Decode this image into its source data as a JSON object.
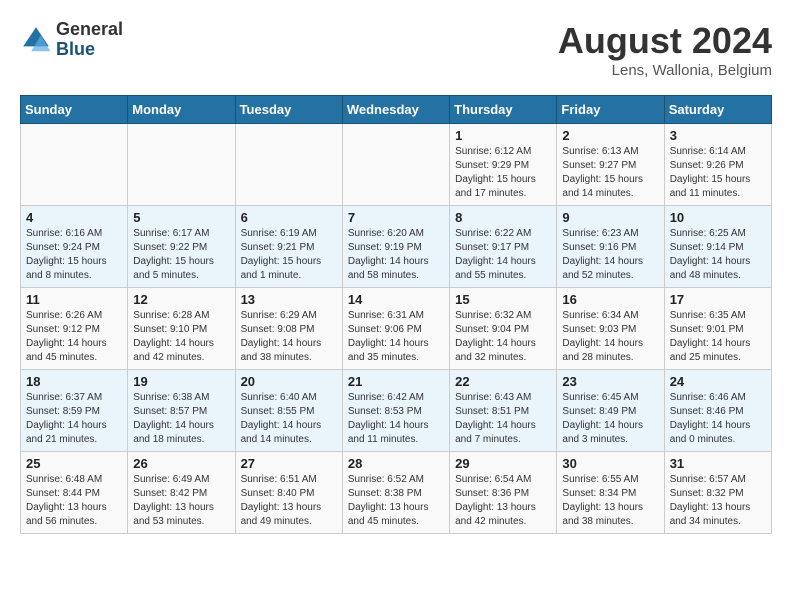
{
  "header": {
    "logo_general": "General",
    "logo_blue": "Blue",
    "month_title": "August 2024",
    "location": "Lens, Wallonia, Belgium"
  },
  "weekdays": [
    "Sunday",
    "Monday",
    "Tuesday",
    "Wednesday",
    "Thursday",
    "Friday",
    "Saturday"
  ],
  "weeks": [
    [
      {
        "day": "",
        "content": ""
      },
      {
        "day": "",
        "content": ""
      },
      {
        "day": "",
        "content": ""
      },
      {
        "day": "",
        "content": ""
      },
      {
        "day": "1",
        "content": "Sunrise: 6:12 AM\nSunset: 9:29 PM\nDaylight: 15 hours and 17 minutes."
      },
      {
        "day": "2",
        "content": "Sunrise: 6:13 AM\nSunset: 9:27 PM\nDaylight: 15 hours and 14 minutes."
      },
      {
        "day": "3",
        "content": "Sunrise: 6:14 AM\nSunset: 9:26 PM\nDaylight: 15 hours and 11 minutes."
      }
    ],
    [
      {
        "day": "4",
        "content": "Sunrise: 6:16 AM\nSunset: 9:24 PM\nDaylight: 15 hours and 8 minutes."
      },
      {
        "day": "5",
        "content": "Sunrise: 6:17 AM\nSunset: 9:22 PM\nDaylight: 15 hours and 5 minutes."
      },
      {
        "day": "6",
        "content": "Sunrise: 6:19 AM\nSunset: 9:21 PM\nDaylight: 15 hours and 1 minute."
      },
      {
        "day": "7",
        "content": "Sunrise: 6:20 AM\nSunset: 9:19 PM\nDaylight: 14 hours and 58 minutes."
      },
      {
        "day": "8",
        "content": "Sunrise: 6:22 AM\nSunset: 9:17 PM\nDaylight: 14 hours and 55 minutes."
      },
      {
        "day": "9",
        "content": "Sunrise: 6:23 AM\nSunset: 9:16 PM\nDaylight: 14 hours and 52 minutes."
      },
      {
        "day": "10",
        "content": "Sunrise: 6:25 AM\nSunset: 9:14 PM\nDaylight: 14 hours and 48 minutes."
      }
    ],
    [
      {
        "day": "11",
        "content": "Sunrise: 6:26 AM\nSunset: 9:12 PM\nDaylight: 14 hours and 45 minutes."
      },
      {
        "day": "12",
        "content": "Sunrise: 6:28 AM\nSunset: 9:10 PM\nDaylight: 14 hours and 42 minutes."
      },
      {
        "day": "13",
        "content": "Sunrise: 6:29 AM\nSunset: 9:08 PM\nDaylight: 14 hours and 38 minutes."
      },
      {
        "day": "14",
        "content": "Sunrise: 6:31 AM\nSunset: 9:06 PM\nDaylight: 14 hours and 35 minutes."
      },
      {
        "day": "15",
        "content": "Sunrise: 6:32 AM\nSunset: 9:04 PM\nDaylight: 14 hours and 32 minutes."
      },
      {
        "day": "16",
        "content": "Sunrise: 6:34 AM\nSunset: 9:03 PM\nDaylight: 14 hours and 28 minutes."
      },
      {
        "day": "17",
        "content": "Sunrise: 6:35 AM\nSunset: 9:01 PM\nDaylight: 14 hours and 25 minutes."
      }
    ],
    [
      {
        "day": "18",
        "content": "Sunrise: 6:37 AM\nSunset: 8:59 PM\nDaylight: 14 hours and 21 minutes."
      },
      {
        "day": "19",
        "content": "Sunrise: 6:38 AM\nSunset: 8:57 PM\nDaylight: 14 hours and 18 minutes."
      },
      {
        "day": "20",
        "content": "Sunrise: 6:40 AM\nSunset: 8:55 PM\nDaylight: 14 hours and 14 minutes."
      },
      {
        "day": "21",
        "content": "Sunrise: 6:42 AM\nSunset: 8:53 PM\nDaylight: 14 hours and 11 minutes."
      },
      {
        "day": "22",
        "content": "Sunrise: 6:43 AM\nSunset: 8:51 PM\nDaylight: 14 hours and 7 minutes."
      },
      {
        "day": "23",
        "content": "Sunrise: 6:45 AM\nSunset: 8:49 PM\nDaylight: 14 hours and 3 minutes."
      },
      {
        "day": "24",
        "content": "Sunrise: 6:46 AM\nSunset: 8:46 PM\nDaylight: 14 hours and 0 minutes."
      }
    ],
    [
      {
        "day": "25",
        "content": "Sunrise: 6:48 AM\nSunset: 8:44 PM\nDaylight: 13 hours and 56 minutes."
      },
      {
        "day": "26",
        "content": "Sunrise: 6:49 AM\nSunset: 8:42 PM\nDaylight: 13 hours and 53 minutes."
      },
      {
        "day": "27",
        "content": "Sunrise: 6:51 AM\nSunset: 8:40 PM\nDaylight: 13 hours and 49 minutes."
      },
      {
        "day": "28",
        "content": "Sunrise: 6:52 AM\nSunset: 8:38 PM\nDaylight: 13 hours and 45 minutes."
      },
      {
        "day": "29",
        "content": "Sunrise: 6:54 AM\nSunset: 8:36 PM\nDaylight: 13 hours and 42 minutes."
      },
      {
        "day": "30",
        "content": "Sunrise: 6:55 AM\nSunset: 8:34 PM\nDaylight: 13 hours and 38 minutes."
      },
      {
        "day": "31",
        "content": "Sunrise: 6:57 AM\nSunset: 8:32 PM\nDaylight: 13 hours and 34 minutes."
      }
    ]
  ]
}
